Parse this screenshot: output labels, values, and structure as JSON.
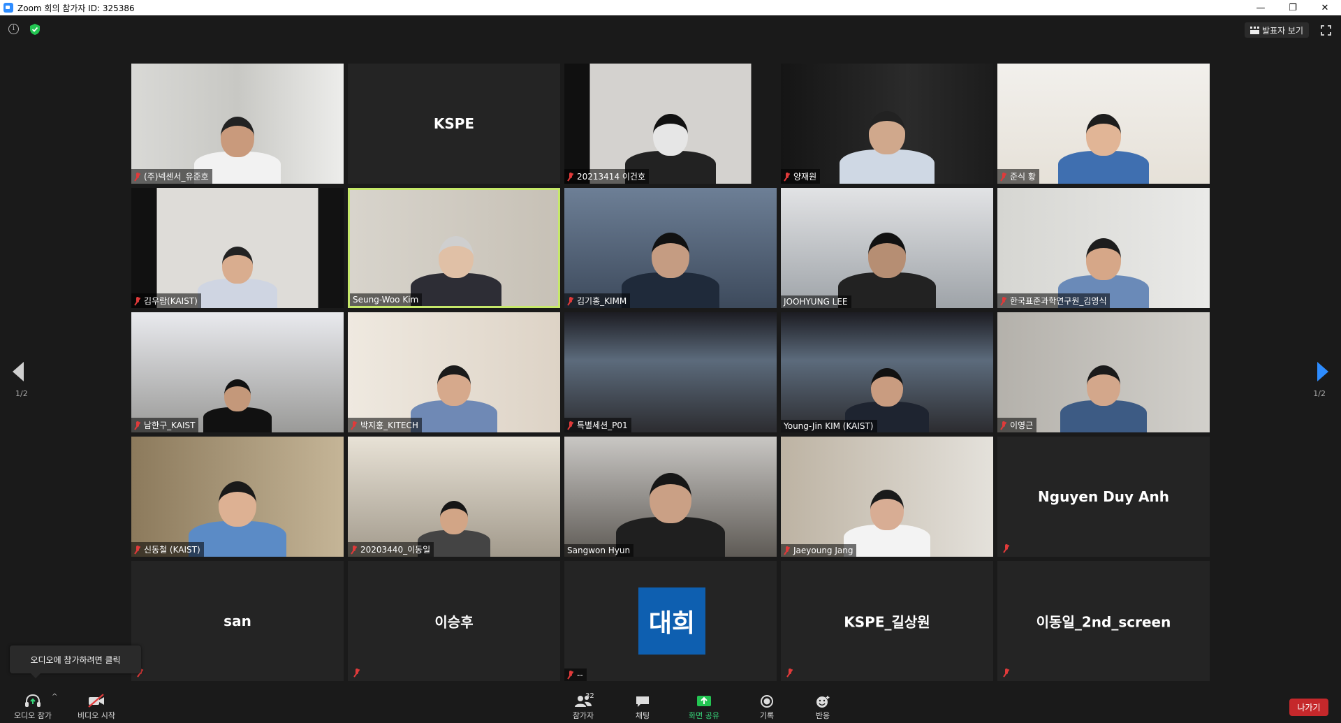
{
  "window": {
    "title": "Zoom 회의 참가자 ID: 325386",
    "minimize": "—",
    "restore": "❐",
    "close": "✕"
  },
  "topbar": {
    "speaker_view": "발표자 보기"
  },
  "pagination": {
    "left": "1/2",
    "right": "1/2"
  },
  "participants": [
    {
      "name": "(주)넥센서_유준호",
      "video": true,
      "muted": true
    },
    {
      "name": "KSPE",
      "video": false,
      "muted": false,
      "center": true
    },
    {
      "name": "20213414 이건호",
      "video": true,
      "muted": true
    },
    {
      "name": "양재원",
      "video": true,
      "muted": true
    },
    {
      "name": "준식 황",
      "video": true,
      "muted": true
    },
    {
      "name": "김우람(KAIST)",
      "video": true,
      "muted": true
    },
    {
      "name": "Seung-Woo Kim",
      "video": true,
      "muted": false,
      "active": true
    },
    {
      "name": "김기홍_KIMM",
      "video": true,
      "muted": true
    },
    {
      "name": "JOOHYUNG LEE",
      "video": true,
      "muted": false
    },
    {
      "name": "한국표준과학연구원_김영식",
      "video": true,
      "muted": true
    },
    {
      "name": "남한구_KAIST",
      "video": true,
      "muted": true
    },
    {
      "name": "박지홍_KITECH",
      "video": true,
      "muted": true
    },
    {
      "name": "특별세션_P01",
      "video": true,
      "muted": true
    },
    {
      "name": "Young-Jin KIM (KAIST)",
      "video": true,
      "muted": false
    },
    {
      "name": "이영근",
      "video": true,
      "muted": true
    },
    {
      "name": "신동철 (KAIST)",
      "video": true,
      "muted": true
    },
    {
      "name": "20203440_이동일",
      "video": true,
      "muted": true
    },
    {
      "name": "Sangwon Hyun",
      "video": true,
      "muted": false
    },
    {
      "name": "Jaeyoung Jang",
      "video": true,
      "muted": true
    },
    {
      "name": "Nguyen Duy Anh",
      "video": false,
      "muted": true,
      "center": true
    },
    {
      "name": "san",
      "video": false,
      "muted": true,
      "center": true
    },
    {
      "name": "이승후",
      "video": false,
      "muted": true,
      "center": true
    },
    {
      "name": "--",
      "video": false,
      "muted": true,
      "avatar": "대희"
    },
    {
      "name": "KSPE_길상원",
      "video": false,
      "muted": true,
      "center": true
    },
    {
      "name": "이동일_2nd_screen",
      "video": false,
      "muted": true,
      "center": true
    }
  ],
  "tooltip": {
    "text": "오디오에 참가하려면 클릭"
  },
  "toolbar": {
    "join_audio": "오디오 참가",
    "start_video": "비디오 시작",
    "participants": "참가자",
    "participant_count": "32",
    "chat": "채팅",
    "share_screen": "화면 공유",
    "record": "기록",
    "reactions": "반응",
    "leave": "나가기"
  },
  "colors": {
    "accent": "#2d8cff",
    "active_border": "#c6e86a",
    "leave": "#c5282b",
    "share": "#37d67a",
    "muted": "#e03a3a",
    "avatar": "#0e5fb0"
  }
}
